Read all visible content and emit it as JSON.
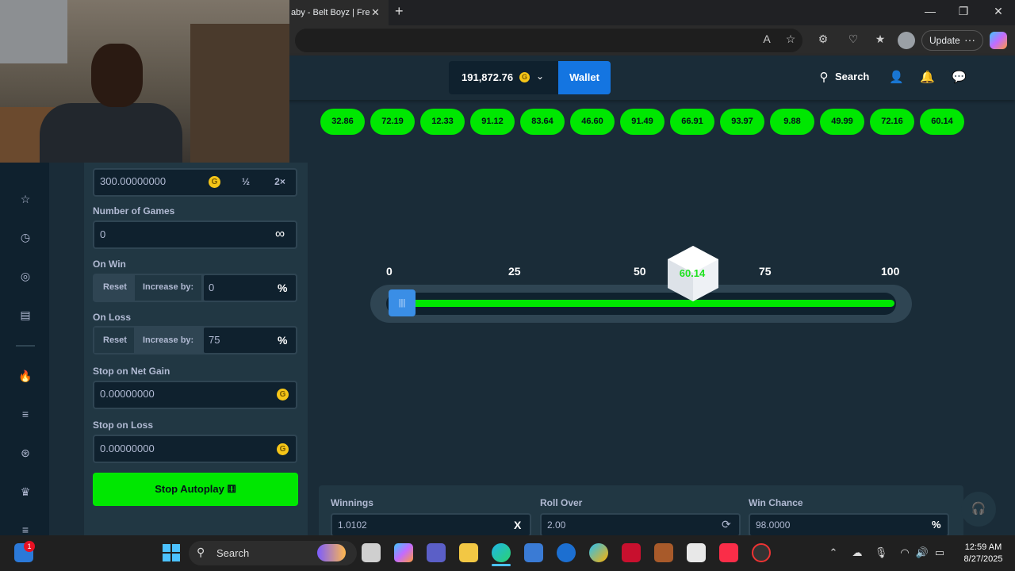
{
  "browser": {
    "tab_title": "aby - Belt Boyz | Fre",
    "tab_close": "✕",
    "new_tab": "+",
    "window_controls": [
      "—",
      "❐",
      "✕"
    ],
    "update_label": "Update",
    "more_dots": "···"
  },
  "header": {
    "balance": "191,872.76",
    "coin_symbol": "G",
    "wallet_label": "Wallet",
    "search_label": "Search"
  },
  "bet_panel": {
    "bet_amount": "300.00000000",
    "half_label": "½",
    "double_label": "2×",
    "games_label": "Number of Games",
    "games_value": "0",
    "infinite_icon": "∞",
    "on_win_label": "On Win",
    "on_win_reset": "Reset",
    "on_win_increase": "Increase by:",
    "on_win_value": "0",
    "on_loss_label": "On Loss",
    "on_loss_reset": "Reset",
    "on_loss_increase": "Increase by:",
    "on_loss_value": "75",
    "percent": "%",
    "stop_gain_label": "Stop on Net Gain",
    "stop_gain_value": "0.00000000",
    "stop_loss_label": "Stop on Loss",
    "stop_loss_value": "0.00000000",
    "stop_button": "Stop Autoplay"
  },
  "results": [
    "32.86",
    "72.19",
    "12.33",
    "91.12",
    "83.64",
    "46.60",
    "91.49",
    "66.91",
    "93.97",
    "9.88",
    "49.99",
    "72.16",
    "60.14"
  ],
  "slider": {
    "ticks": [
      "0",
      "25",
      "50",
      "75",
      "100"
    ],
    "handle_value": 2,
    "handle_glyph": "|||",
    "dice_value": "60.14"
  },
  "stats": {
    "winnings_label": "Winnings",
    "winnings_value": "1.0102",
    "winnings_icon": "X",
    "roll_over_label": "Roll Over",
    "roll_over_value": "2.00",
    "roll_over_icon": "⟳",
    "win_chance_label": "Win Chance",
    "win_chance_value": "98.0000",
    "win_chance_icon": "%"
  },
  "taskbar": {
    "search_label": "Search",
    "badge": "1",
    "time": "12:59 AM",
    "date": "8/27/2025"
  },
  "colors": {
    "accent_green": "#00e701",
    "wallet_blue": "#1475e1",
    "panel": "#213743",
    "background": "#1a2c38"
  }
}
